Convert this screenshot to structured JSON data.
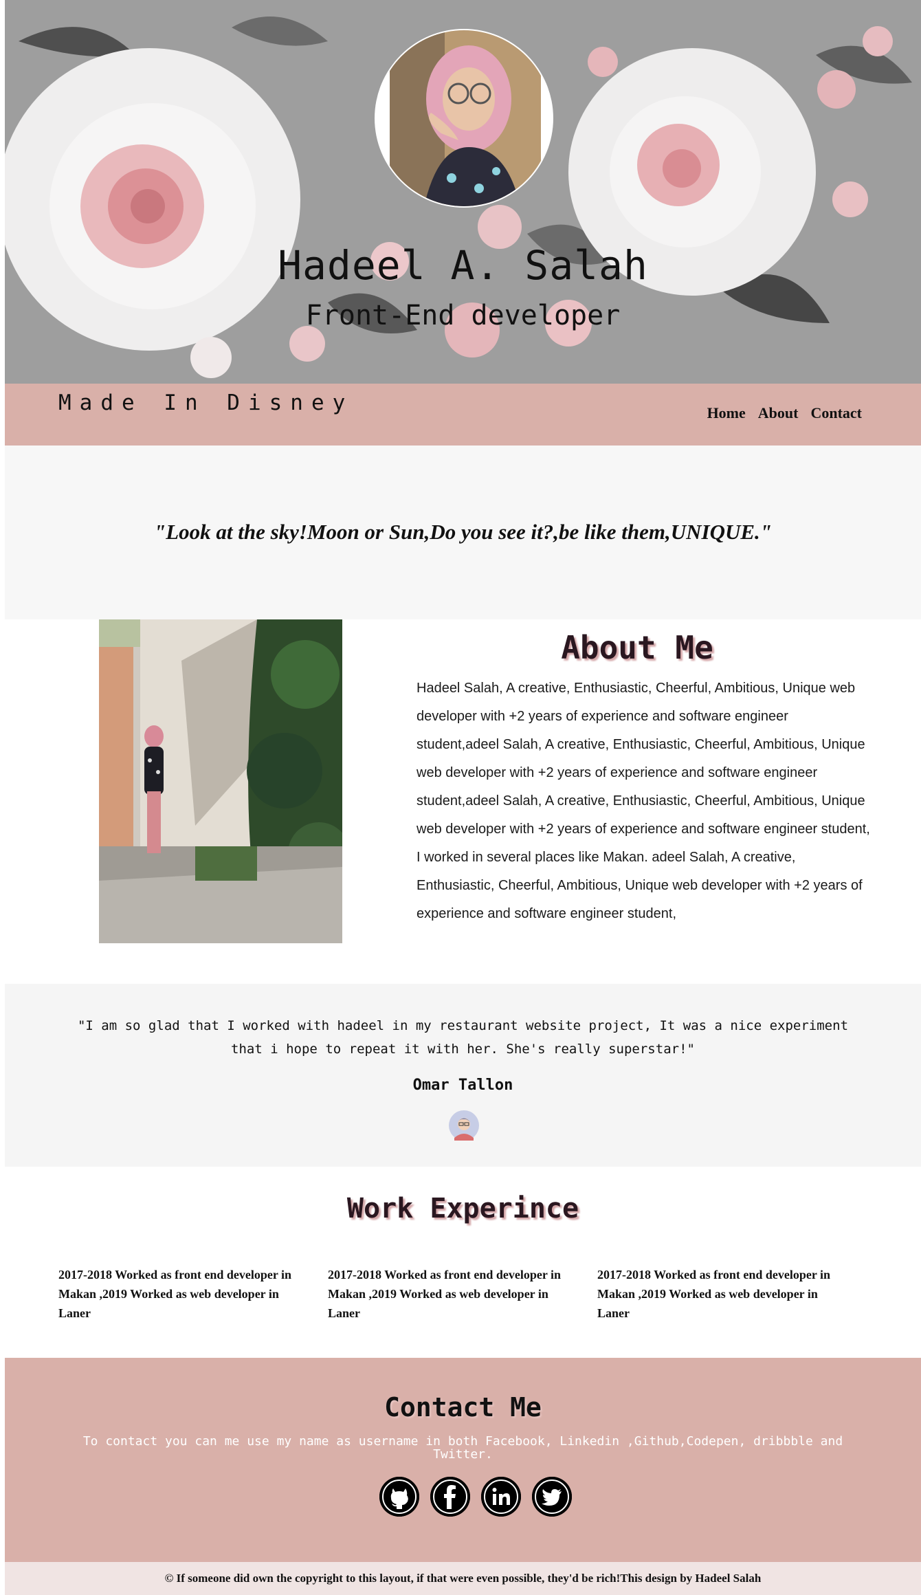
{
  "hero": {
    "name": "Hadeel A. Salah",
    "role": "Front-End developer"
  },
  "nav": {
    "brand": "Made In Disney",
    "links": [
      "Home",
      "About",
      "Contact"
    ]
  },
  "quote": "\"Look at the sky!Moon or Sun,Do you see it?,be like them,UNIQUE.\"",
  "about": {
    "title": "About Me",
    "text": "Hadeel Salah, A creative, Enthusiastic, Cheerful, Ambitious, Unique web developer with +2 years of experience and software engineer student,adeel Salah, A creative, Enthusiastic, Cheerful, Ambitious, Unique web developer with +2 years of experience and software engineer student,adeel Salah, A creative, Enthusiastic, Cheerful, Ambitious, Unique web developer with +2 years of experience and software engineer student, I worked in several places like Makan. adeel Salah, A creative, Enthusiastic, Cheerful, Ambitious, Unique web developer with +2 years of experience and software engineer student,"
  },
  "testimonial": {
    "text": "\"I am so glad that I worked with hadeel in my restaurant website project, It was a nice experiment that i hope to repeat it with her. She's really superstar!\"",
    "name": "Omar Tallon"
  },
  "work": {
    "title": "Work Experince",
    "items": [
      "2017-2018 Worked as front end developer in Makan ,2019 Worked as web developer in Laner",
      "2017-2018 Worked as front end developer in Makan ,2019 Worked as web developer in Laner",
      "2017-2018 Worked as front end developer in Makan ,2019 Worked as web developer in Laner"
    ]
  },
  "contact": {
    "title": "Contact Me",
    "text": "To contact you can me use my name as username in both Facebook, Linkedin ,Github,Codepen, dribbble and Twitter.",
    "socials": [
      "github-icon",
      "facebook-icon",
      "linkedin-icon",
      "twitter-icon"
    ]
  },
  "footer": {
    "text": "© If someone did own the copyright to this layout, if that were even possible, they'd be rich!This design by Hadeel Salah"
  },
  "colors": {
    "nav_bg": "#d9b0a9",
    "contact_bg": "#d9b0a9",
    "title_shadow": "#d4a6a8"
  }
}
